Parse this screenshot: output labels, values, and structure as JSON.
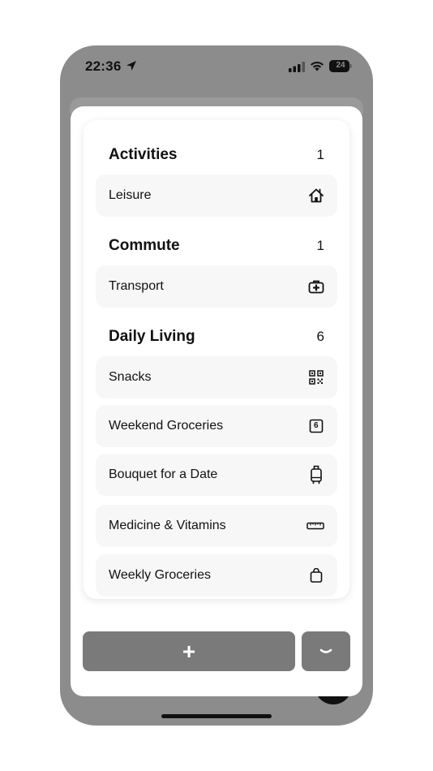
{
  "status_bar": {
    "time": "22:36",
    "battery": "24"
  },
  "sections": [
    {
      "title": "Activities",
      "count": "1",
      "items": [
        {
          "label": "Leisure",
          "icon": "house-icon"
        }
      ]
    },
    {
      "title": "Commute",
      "count": "1",
      "items": [
        {
          "label": "Transport",
          "icon": "medical-bag-icon"
        }
      ]
    },
    {
      "title": "Daily Living",
      "count": "6",
      "items": [
        {
          "label": "Snacks",
          "icon": "qr-code-icon"
        },
        {
          "label": "Weekend Groceries",
          "icon": "calendar-6-icon",
          "icon_text": "6"
        },
        {
          "label": "Bouquet for a Date",
          "icon": "suitcase-icon"
        },
        {
          "label": "Medicine & Vitamins",
          "icon": "ruler-icon"
        },
        {
          "label": "Weekly Groceries",
          "icon": "bag-icon"
        }
      ]
    }
  ],
  "actions": {
    "add_label": "+",
    "collapse_icon": "chevron-down-icon"
  },
  "colors": {
    "backdrop": "#8c8c8c",
    "row_background": "#f7f7f7",
    "button_background": "#7a7a7a"
  }
}
